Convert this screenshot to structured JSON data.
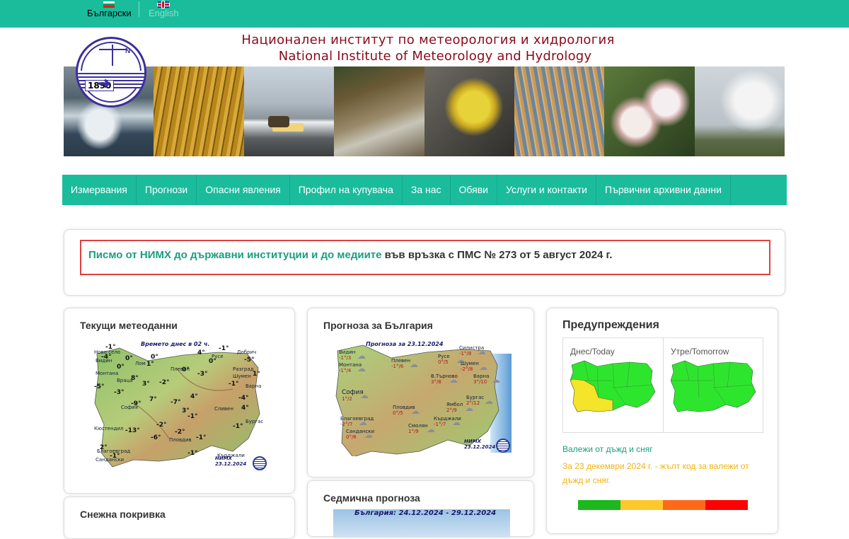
{
  "languages": {
    "bg": "Български",
    "en": "English"
  },
  "header": {
    "title_bg": "Национален институт по метеорология и хидрология",
    "title_en": "National Institute of Meteorology and Hydrology",
    "logo_year": "1890",
    "logo_letter": "N"
  },
  "nav": [
    "Измервания",
    "Прогнози",
    "Опасни явления",
    "Профил на купувача",
    "За нас",
    "Обяви",
    "Услуги и контакти",
    "Първични архивни данни"
  ],
  "notice": {
    "link": "Писмо от НИМХ до държавни институции и до медиите",
    "text": " във връзка с ПМС № 273 от 5 август 2024 г."
  },
  "cards": {
    "current": "Текущи метеоданни",
    "forecast": "Прогноза за България",
    "warnings": "Предупреждения",
    "snow": "Снежна покривка",
    "weekly": "Седмична прогноза"
  },
  "current_map": {
    "title": "Времето днес в 02 ч.",
    "sign": "НИМХ",
    "date": "23.12.2024",
    "temps": [
      "-1°",
      "-4°",
      "0°",
      "0°",
      "1°",
      "0°",
      "4°",
      "0°",
      "-1°",
      "-5°",
      "1°",
      "-3°",
      "0°",
      "8°",
      "3°",
      "-5°",
      "-3°",
      "-2°",
      "-9°",
      "7°",
      "-4°",
      "4°",
      "-7°",
      "-1°",
      "4°",
      "3°",
      "-13°",
      "-2°",
      "-1°",
      "-6°",
      "-2°",
      "-1°",
      "2°",
      "-1°",
      "-1°",
      "-1°"
    ],
    "labels": [
      "Ново село",
      "Видин",
      "Лом",
      "Монтана",
      "Враца",
      "Плевен",
      "Русе",
      "Разград",
      "Добрич",
      "Шумен",
      "Варна",
      "София",
      "Сливен",
      "Бургас",
      "Пловдив",
      "Кърджали",
      "Благоевград",
      "Сандански",
      "Кюстендил"
    ]
  },
  "forecast_map": {
    "title": "Прогноза за 23.12.2024",
    "sign": "НИМХ",
    "date": "23.12.2024",
    "cities": [
      "Видин",
      "Монтана",
      "Плевен",
      "Русе",
      "Силистра",
      "Шумен",
      "Варна",
      "В.Търново",
      "Бургас",
      "Ямбол",
      "София",
      "Пловдив",
      "Благоевград",
      "Сандански",
      "Смолян",
      "Кърджали"
    ],
    "temps": [
      "-1°/3",
      "-1°/4",
      "-1°/6",
      "0°/5",
      "-1°/8",
      "-2°/8",
      "3°/10",
      "3°/8",
      "2°/12",
      "2°/9",
      "1°/2",
      "0°/5",
      "-2°/7",
      "0°/6",
      "1°/9",
      "-1°/7"
    ]
  },
  "warnings": {
    "today": "Днес/Today",
    "tomorrow": "Утре/Tomorrow",
    "type": "Валежи от дъжд и сняг",
    "text": "За 23 декември 2024 г. - жълт код за валежи от дъжд и сняг.",
    "legend_colors": [
      "#1cb81c",
      "#ffc82d",
      "#ff6a1a",
      "#ff0000"
    ],
    "map_colors": {
      "green": "#2ee52e",
      "yellow": "#f4e52a"
    }
  },
  "weekly": {
    "title": "България: 24.12.2024 - 29.12.2024"
  },
  "colors": {
    "accent": "#1abc9c",
    "title": "#8b0a1a",
    "link": "#1a9e83",
    "warning": "#f5b20f",
    "notice_border": "#e04040"
  }
}
